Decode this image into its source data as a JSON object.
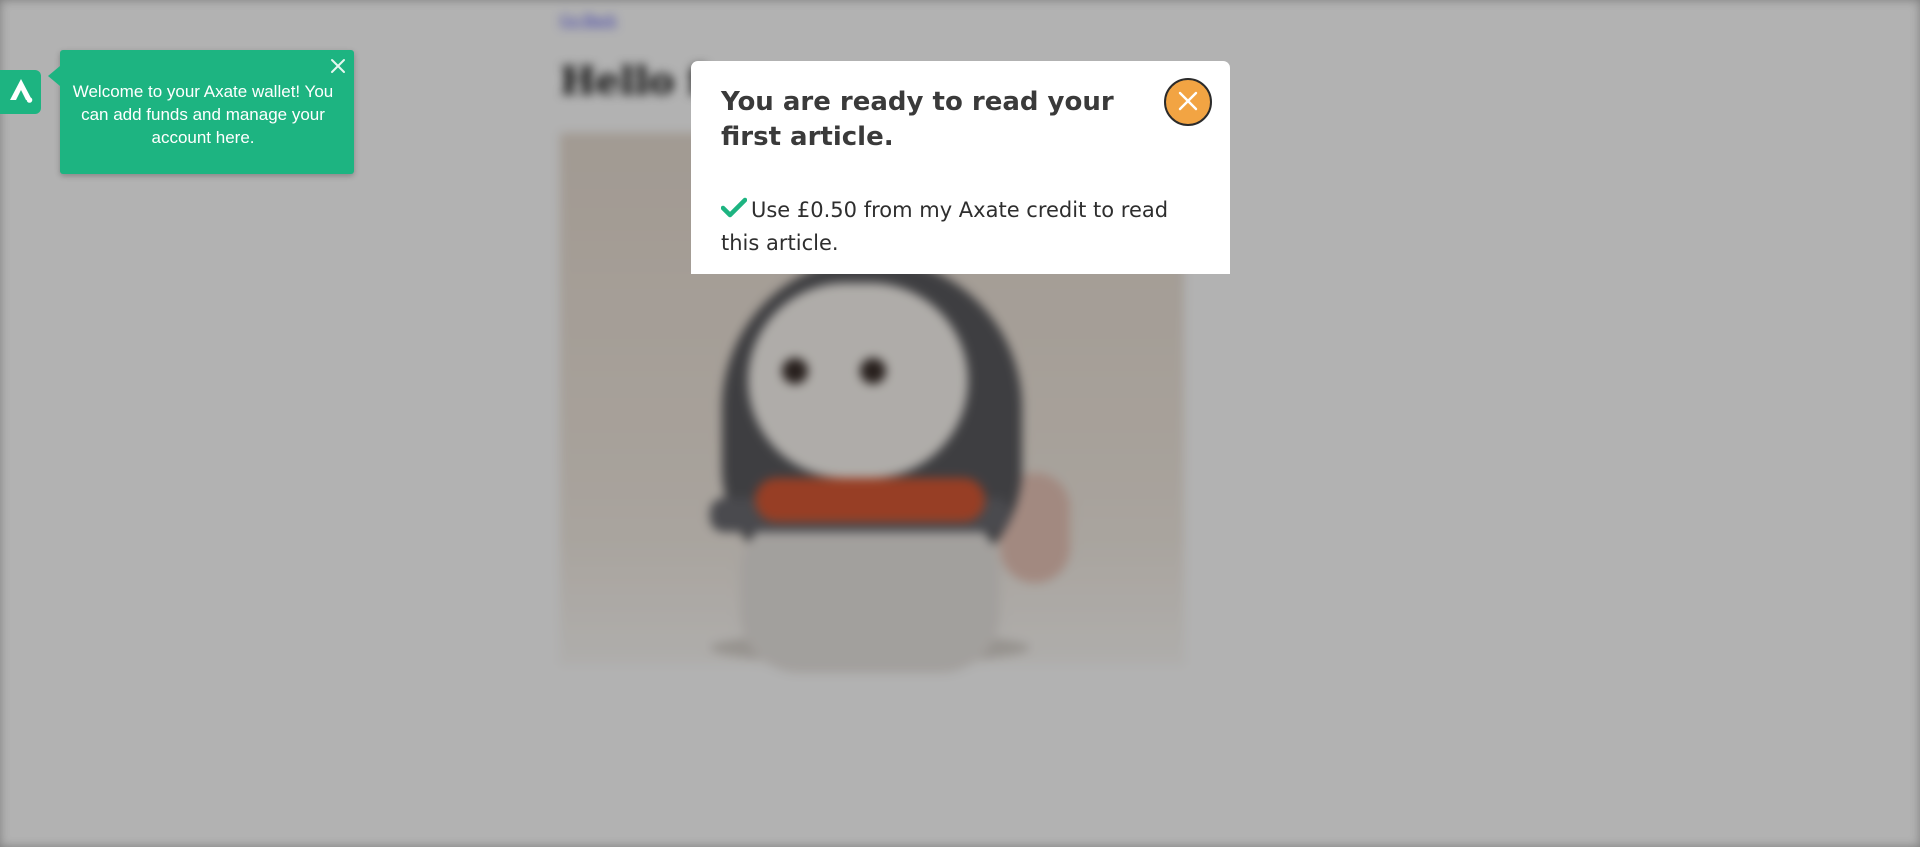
{
  "article": {
    "back_link": "Go Back",
    "title": "Hello fr"
  },
  "wallet": {
    "tooltip_text": "Welcome to your Axate wallet! You can add funds and manage your account here.",
    "accent_color": "#1db481",
    "logo_icon": "axate-logo-icon",
    "close_icon": "close-icon"
  },
  "modal": {
    "title": "You are ready to read your first article.",
    "option_text": "Use £0.50 from my Axate credit to read this article.",
    "option_icon": "checkmark-icon",
    "close_icon": "close-icon",
    "close_button_color": "#f2a443"
  }
}
